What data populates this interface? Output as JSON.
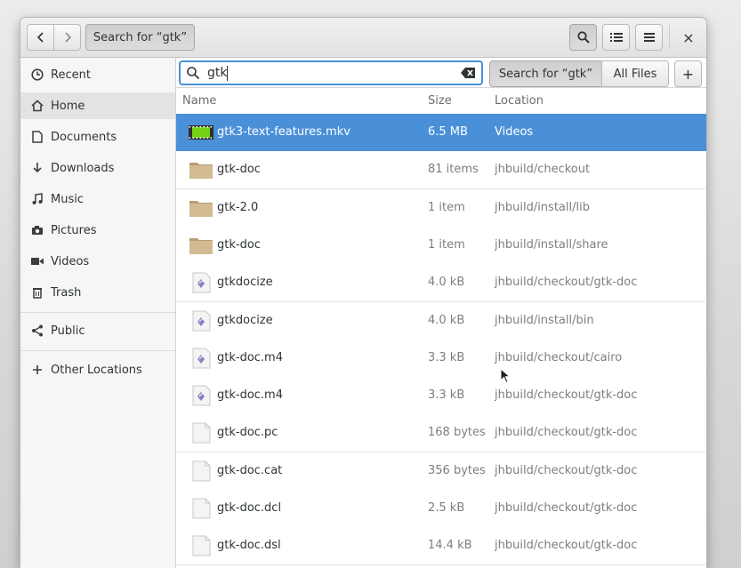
{
  "header": {
    "back_label": "‹",
    "forward_label": "›",
    "path_button": "Search for “gtk”",
    "search_icon": "search-icon",
    "view_list_icon": "view-list-icon",
    "menu_icon": "menu-icon",
    "close_icon": "close-icon",
    "close_glyph": "×"
  },
  "sidebar": {
    "items": [
      {
        "label": "Recent",
        "icon": "clock-icon"
      },
      {
        "label": "Home",
        "icon": "home-icon"
      },
      {
        "label": "Documents",
        "icon": "document-icon"
      },
      {
        "label": "Downloads",
        "icon": "download-icon"
      },
      {
        "label": "Music",
        "icon": "music-icon"
      },
      {
        "label": "Pictures",
        "icon": "camera-icon"
      },
      {
        "label": "Videos",
        "icon": "video-icon"
      },
      {
        "label": "Trash",
        "icon": "trash-icon"
      },
      {
        "label": "Public",
        "icon": "share-icon"
      },
      {
        "label": "Other Locations",
        "icon": "plus-icon"
      }
    ],
    "active_index": 1
  },
  "search": {
    "value": "gtk",
    "scope_search": "Search for “gtk”",
    "scope_all": "All Files",
    "add_label": "+"
  },
  "columns": {
    "name": "Name",
    "size": "Size",
    "location": "Location"
  },
  "files": [
    {
      "name": "gtk3-text-features.mkv",
      "size": "6.5 MB",
      "location": "Videos",
      "type": "video",
      "selected": true
    },
    {
      "name": "gtk-doc",
      "size": "81 items",
      "location": "jhbuild/checkout",
      "type": "folder"
    },
    {
      "name": "gtk-2.0",
      "size": "1 item",
      "location": "jhbuild/install/lib",
      "type": "folder"
    },
    {
      "name": "gtk-doc",
      "size": "1 item",
      "location": "jhbuild/install/share",
      "type": "folder"
    },
    {
      "name": "gtkdocize",
      "size": "4.0 kB",
      "location": "jhbuild/checkout/gtk-doc",
      "type": "script"
    },
    {
      "name": "gtkdocize",
      "size": "4.0 kB",
      "location": "jhbuild/install/bin",
      "type": "script"
    },
    {
      "name": "gtk-doc.m4",
      "size": "3.3 kB",
      "location": "jhbuild/checkout/cairo",
      "type": "script"
    },
    {
      "name": "gtk-doc.m4",
      "size": "3.3 kB",
      "location": "jhbuild/checkout/gtk-doc",
      "type": "script"
    },
    {
      "name": "gtk-doc.pc",
      "size": "168 bytes",
      "location": "jhbuild/checkout/gtk-doc",
      "type": "text"
    },
    {
      "name": "gtk-doc.cat",
      "size": "356 bytes",
      "location": "jhbuild/checkout/gtk-doc",
      "type": "text"
    },
    {
      "name": "gtk-doc.dcl",
      "size": "2.5 kB",
      "location": "jhbuild/checkout/gtk-doc",
      "type": "text"
    },
    {
      "name": "gtk-doc.dsl",
      "size": "14.4 kB",
      "location": "jhbuild/checkout/gtk-doc",
      "type": "text"
    }
  ],
  "colors": {
    "accent": "#4a90d9",
    "folder": "#c9b089",
    "selection_text": "#ffffff"
  }
}
